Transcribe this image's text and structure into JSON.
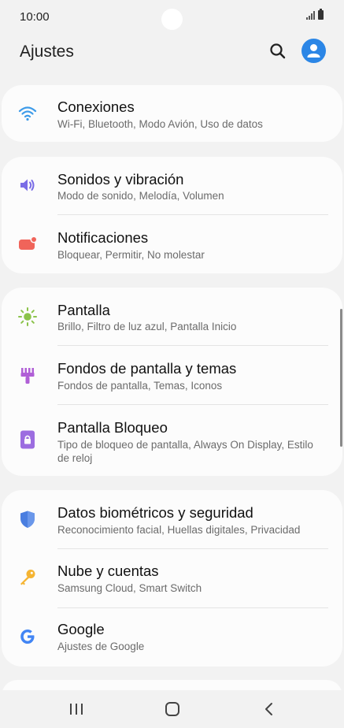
{
  "status_bar": {
    "time": "10:00"
  },
  "header": {
    "title": "Ajustes"
  },
  "cards": [
    {
      "items": [
        {
          "title": "Conexiones",
          "subtitle": "Wi-Fi, Bluetooth, Modo Avión, Uso de datos",
          "icon": "wifi-icon",
          "color": "#3d9be9"
        }
      ]
    },
    {
      "items": [
        {
          "title": "Sonidos y vibración",
          "subtitle": "Modo de sonido, Melodía, Volumen",
          "icon": "speaker-icon",
          "color": "#7a6de6"
        },
        {
          "title": "Notificaciones",
          "subtitle": "Bloquear, Permitir, No molestar",
          "icon": "notification-icon",
          "color": "#f0645a"
        }
      ]
    },
    {
      "items": [
        {
          "title": "Pantalla",
          "subtitle": "Brillo, Filtro de luz azul, Pantalla Inicio",
          "icon": "brightness-icon",
          "color": "#8bc34a"
        },
        {
          "title": "Fondos de pantalla y temas",
          "subtitle": "Fondos de pantalla, Temas, Iconos",
          "icon": "paint-brush-icon",
          "color": "#b05fd6"
        },
        {
          "title": "Pantalla Bloqueo",
          "subtitle": "Tipo de bloqueo de pantalla, Always On Display, Estilo de reloj",
          "icon": "lock-screen-icon",
          "color": "#9c6de0"
        }
      ]
    },
    {
      "items": [
        {
          "title": "Datos biométricos y seguridad",
          "subtitle": "Reconocimiento facial, Huellas digitales, Privacidad",
          "icon": "shield-icon",
          "color": "#4a7ee0"
        },
        {
          "title": "Nube y cuentas",
          "subtitle": "Samsung Cloud, Smart Switch",
          "icon": "key-icon",
          "color": "#f5b432"
        },
        {
          "title": "Google",
          "subtitle": "Ajustes de Google",
          "icon": "google-icon",
          "color": "#4285f4"
        }
      ]
    }
  ],
  "nav_bar": {
    "recents": "recents-icon",
    "home": "home-icon",
    "back": "back-icon"
  }
}
